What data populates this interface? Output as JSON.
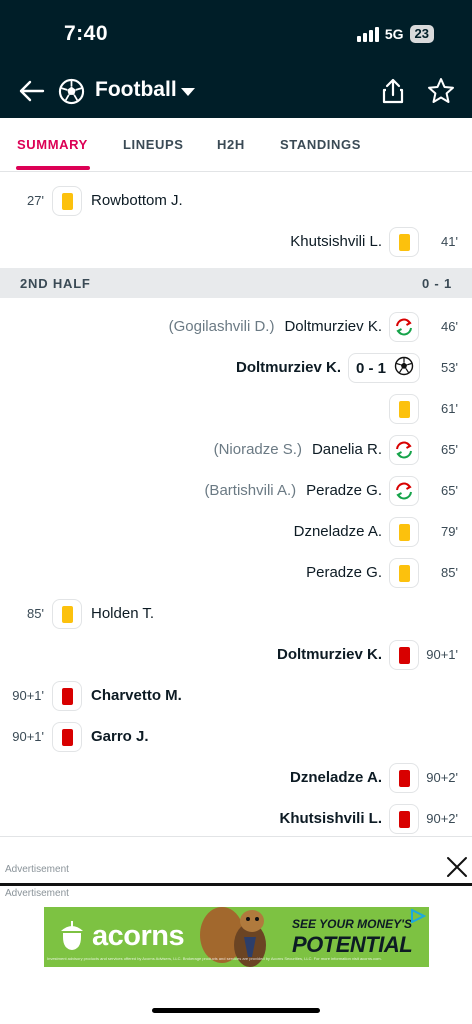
{
  "status_bar": {
    "time": "7:40",
    "network": "5G",
    "battery": "23"
  },
  "header": {
    "title": "Football",
    "back_icon": "back-arrow-icon",
    "sport_icon": "soccer-ball-icon",
    "share_icon": "share-icon",
    "favorite_icon": "star-icon"
  },
  "tabs": [
    {
      "label": "SUMMARY",
      "active": true
    },
    {
      "label": "LINEUPS",
      "active": false
    },
    {
      "label": "H2H",
      "active": false
    },
    {
      "label": "STANDINGS",
      "active": false
    }
  ],
  "incidents_first": [
    {
      "side": "home",
      "minute": "27'",
      "type": "yellow-card",
      "player": "Rowbottom J.",
      "bold": false
    },
    {
      "side": "away",
      "minute": "41'",
      "type": "yellow-card",
      "player": "Khutsishvili L.",
      "bold": false
    }
  ],
  "second_half": {
    "label": "2ND HALF",
    "score": "0 - 1"
  },
  "incidents_second": [
    {
      "side": "away",
      "minute": "46'",
      "type": "substitution",
      "player": "Doltmurziev K.",
      "assist": "(Gogilashvili D.)",
      "bold": false
    },
    {
      "side": "away",
      "minute": "53'",
      "type": "goal",
      "player": "Doltmurziev K.",
      "score": "0 - 1",
      "bold": true
    },
    {
      "side": "away",
      "minute": "61'",
      "type": "yellow-card",
      "player": "",
      "bold": false
    },
    {
      "side": "away",
      "minute": "65'",
      "type": "substitution",
      "player": "Danelia R.",
      "assist": "(Nioradze S.)",
      "bold": false
    },
    {
      "side": "away",
      "minute": "65'",
      "type": "substitution",
      "player": "Peradze G.",
      "assist": "(Bartishvili A.)",
      "bold": false
    },
    {
      "side": "away",
      "minute": "79'",
      "type": "yellow-card",
      "player": "Dzneladze A.",
      "bold": false
    },
    {
      "side": "away",
      "minute": "85'",
      "type": "yellow-card",
      "player": "Peradze G.",
      "bold": false
    },
    {
      "side": "home",
      "minute": "85'",
      "type": "yellow-card",
      "player": "Holden T.",
      "bold": false
    },
    {
      "side": "away",
      "minute": "90+1'",
      "type": "red-card",
      "player": "Doltmurziev K.",
      "bold": true
    },
    {
      "side": "home",
      "minute": "90+1'",
      "type": "red-card",
      "player": "Charvetto M.",
      "bold": true
    },
    {
      "side": "home",
      "minute": "90+1'",
      "type": "red-card",
      "player": "Garro J.",
      "bold": true
    },
    {
      "side": "away",
      "minute": "90+2'",
      "type": "red-card",
      "player": "Dzneladze A.",
      "bold": true
    },
    {
      "side": "away",
      "minute": "90+2'",
      "type": "red-card",
      "player": "Khutsishvili L.",
      "bold": true
    }
  ],
  "ads": {
    "label_top": "Advertisement",
    "label_banner": "Advertisement",
    "brand": "acorns",
    "tagline_small": "SEE YOUR MONEY'S",
    "tagline_big": "POTENTIAL",
    "disclaimer": "Investment advisory products and services offered by Acorns Advisers, LLC. Brokerage products and services are provided by Acorns Securities, LLC. For more information visit acorns.com."
  },
  "colors": {
    "accent": "#dc0055",
    "header_bg": "#001e28",
    "yellow_card": "#fcc10d",
    "red_card": "#d80000",
    "ad_green": "#7dc242"
  }
}
